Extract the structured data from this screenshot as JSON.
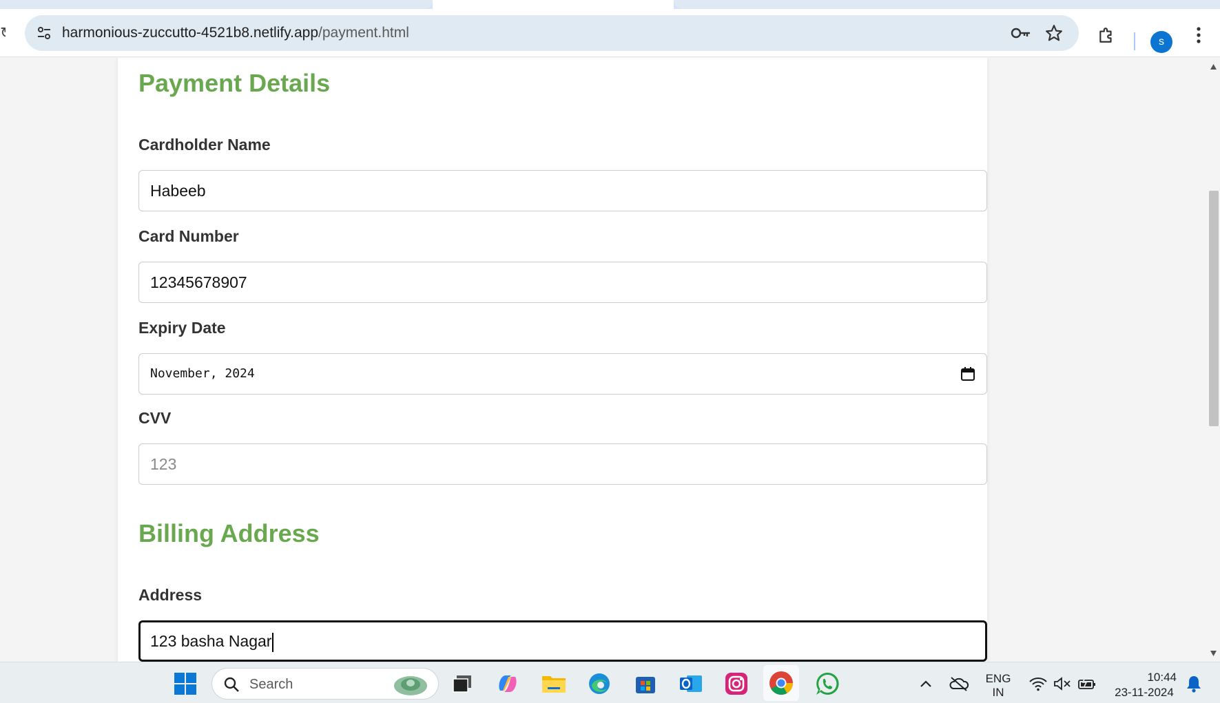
{
  "browser": {
    "url_host": "harmonious-zuccutto-4521b8.netlify.app",
    "url_path": "/payment.html",
    "profile_initial": "s",
    "icons": [
      "reload-icon",
      "site-info-icon",
      "password-key-icon",
      "bookmark-star-icon",
      "extensions-icon",
      "menu-dots-icon"
    ]
  },
  "page": {
    "payment_title": "Payment Details",
    "fields": [
      {
        "label": "Cardholder Name",
        "value": "Habeeb"
      },
      {
        "label": "Card Number",
        "value": "12345678907"
      },
      {
        "label": "Expiry Date",
        "value": "November, 2024"
      },
      {
        "label": "CVV",
        "placeholder": "123"
      }
    ],
    "billing_title": "Billing Address",
    "address": {
      "label": "Address",
      "value": "123 basha Nagar"
    }
  },
  "taskbar": {
    "search_placeholder": "Search",
    "apps": [
      "windows-start-icon",
      "task-view-icon",
      "copilot-icon",
      "file-explorer-icon",
      "edge-icon",
      "store-icon",
      "outlook-icon",
      "instagram-icon",
      "chrome-icon",
      "whatsapp-icon"
    ],
    "lang_top": "ENG",
    "lang_bottom": "IN",
    "time": "10:44",
    "date": "23-11-2024"
  },
  "colors": {
    "accent_green": "#6aa84f",
    "avatar_blue": "#0b75d1",
    "omnibox_bg": "#dfeaf2"
  }
}
